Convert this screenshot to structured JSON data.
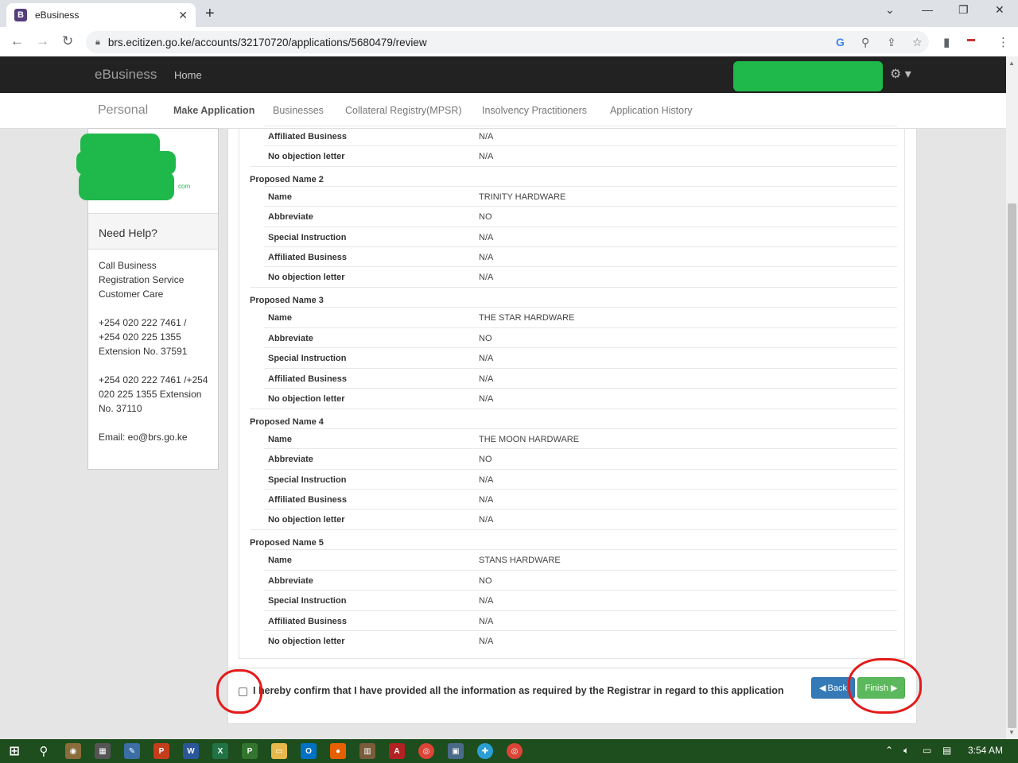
{
  "browser": {
    "tab_title": "eBusiness",
    "tab_favicon": "B",
    "url": "brs.ecitizen.go.ke/accounts/32170720/applications/5680479/review"
  },
  "navbar": {
    "brand": "eBusiness",
    "home": "Home"
  },
  "subnav": {
    "personal": "Personal",
    "items": [
      "Make Application",
      "Businesses",
      "Collateral Registry(MPSR)",
      "Insolvency Practitioners",
      "Application History"
    ]
  },
  "sidebar": {
    "avatar_suffix": "com",
    "help_title": "Need Help?",
    "help_lines": [
      "Call Business Registration Service Customer Care",
      "+254 020 222 7461 / +254 020 225 1355 Extension No. 37591",
      "+254 020 222 7461 /+254 020 225 1355 Extension No. 37110",
      "Email: eo@brs.go.ke"
    ]
  },
  "review": {
    "top_rows": [
      {
        "label": "Affiliated Business",
        "value": "N/A"
      },
      {
        "label": "No objection letter",
        "value": "N/A"
      }
    ],
    "groups": [
      {
        "title": "Proposed Name 2",
        "rows": [
          {
            "label": "Name",
            "value": "TRINITY HARDWARE"
          },
          {
            "label": "Abbreviate",
            "value": "NO"
          },
          {
            "label": "Special Instruction",
            "value": "N/A"
          },
          {
            "label": "Affiliated Business",
            "value": "N/A"
          },
          {
            "label": "No objection letter",
            "value": "N/A"
          }
        ]
      },
      {
        "title": "Proposed Name 3",
        "rows": [
          {
            "label": "Name",
            "value": "THE STAR HARDWARE"
          },
          {
            "label": "Abbreviate",
            "value": "NO"
          },
          {
            "label": "Special Instruction",
            "value": "N/A"
          },
          {
            "label": "Affiliated Business",
            "value": "N/A"
          },
          {
            "label": "No objection letter",
            "value": "N/A"
          }
        ]
      },
      {
        "title": "Proposed Name 4",
        "rows": [
          {
            "label": "Name",
            "value": "THE MOON HARDWARE"
          },
          {
            "label": "Abbreviate",
            "value": "NO"
          },
          {
            "label": "Special Instruction",
            "value": "N/A"
          },
          {
            "label": "Affiliated Business",
            "value": "N/A"
          },
          {
            "label": "No objection letter",
            "value": "N/A"
          }
        ]
      },
      {
        "title": "Proposed Name 5",
        "rows": [
          {
            "label": "Name",
            "value": "STANS HARDWARE"
          },
          {
            "label": "Abbreviate",
            "value": "NO"
          },
          {
            "label": "Special Instruction",
            "value": "N/A"
          },
          {
            "label": "Affiliated Business",
            "value": "N/A"
          },
          {
            "label": "No objection letter",
            "value": "N/A"
          }
        ]
      }
    ]
  },
  "footer": {
    "confirm_text": "I hereby confirm that I have provided all the information as required by the Registrar in regard to this application",
    "back_label": "Back",
    "finish_label": "Finish"
  },
  "taskbar": {
    "time": "3:54 AM",
    "apps": [
      "P",
      "W",
      "X",
      "P",
      "O",
      "A"
    ]
  },
  "colors": {
    "navbar": "#222222",
    "back_button": "#337ab7",
    "finish_button": "#5cb85c",
    "annotation": "#e31b1b",
    "redaction": "#1fb84a"
  }
}
